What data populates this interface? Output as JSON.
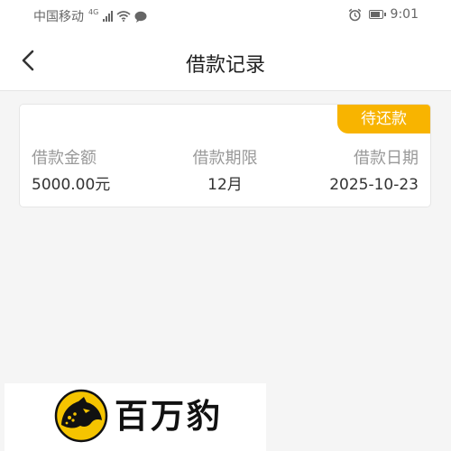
{
  "status_bar": {
    "carrier": "中国移动",
    "network": "4G",
    "time": "9:01",
    "icons": [
      "signal-icon",
      "wifi-icon",
      "message-icon",
      "alarm-icon",
      "battery-icon"
    ]
  },
  "header": {
    "title": "借款记录",
    "back_icon": "chevron-left-icon"
  },
  "record": {
    "status": "待还款",
    "status_color": "#f8b400",
    "fields": [
      {
        "label": "借款金额",
        "value": "5000.00元"
      },
      {
        "label": "借款期限",
        "value": "12月"
      },
      {
        "label": "借款日期",
        "value": "2025-10-23"
      }
    ]
  },
  "brand": {
    "name": "百万豹",
    "logo_icon": "leopard-logo-icon",
    "accent_color": "#f5c400"
  }
}
